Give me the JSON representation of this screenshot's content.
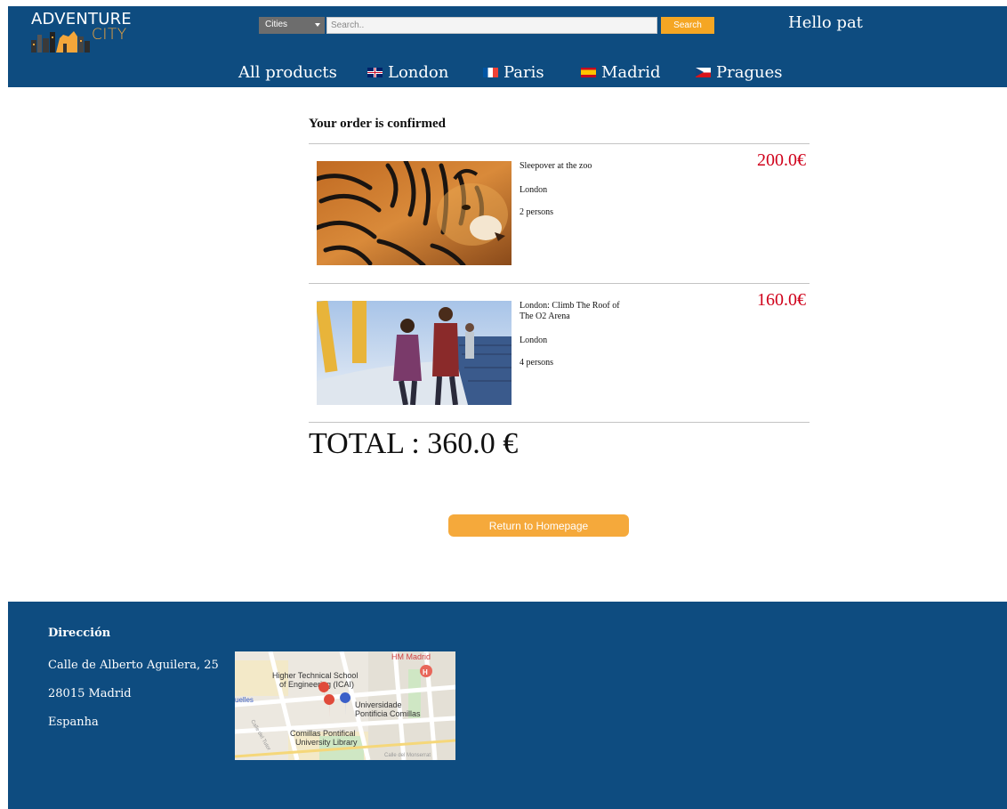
{
  "header": {
    "logo_top": "ADVENTURE",
    "logo_bottom": "CITY",
    "city_select": "Cities",
    "search_placeholder": "Search..",
    "search_button": "Search",
    "greeting": "Hello pat"
  },
  "nav": [
    {
      "label": "All products",
      "flag": ""
    },
    {
      "label": "London",
      "flag": "uk"
    },
    {
      "label": "Paris",
      "flag": "fr"
    },
    {
      "label": "Madrid",
      "flag": "es"
    },
    {
      "label": "Pragues",
      "flag": "cz"
    }
  ],
  "order": {
    "title": "Your order is confirmed",
    "items": [
      {
        "name": "Sleepover at the zoo",
        "city": "London",
        "persons": "2 persons",
        "price": "200.0€"
      },
      {
        "name": "London: Climb The Roof of The O2 Arena",
        "city": "London",
        "persons": "4 persons",
        "price": "160.0€"
      }
    ],
    "total": "TOTAL : 360.0 €",
    "return_button": "Return to Homepage"
  },
  "footer": {
    "heading": "Dirección",
    "address_line1": "Calle de Alberto Aguilera, 25",
    "address_line2": "28015 Madrid",
    "address_line3": "Espanha",
    "map_labels": {
      "hm_madrid": "HM Madrid",
      "icai_line1": "Higher Technical School",
      "icai_line2": "of Engineering (ICAI)",
      "comillas_line1": "Universidade",
      "comillas_line2": "Pontificia Comillas",
      "library_line1": "Comillas Pontifical",
      "library_line2": "University Library",
      "station": "uelles",
      "street_bottom": "Calle del Monserrat",
      "street_side": "Calle del Tutor"
    }
  },
  "colors": {
    "brand_blue": "#0e4c80",
    "accent_orange": "#f5a623",
    "price_red": "#d0021b"
  }
}
